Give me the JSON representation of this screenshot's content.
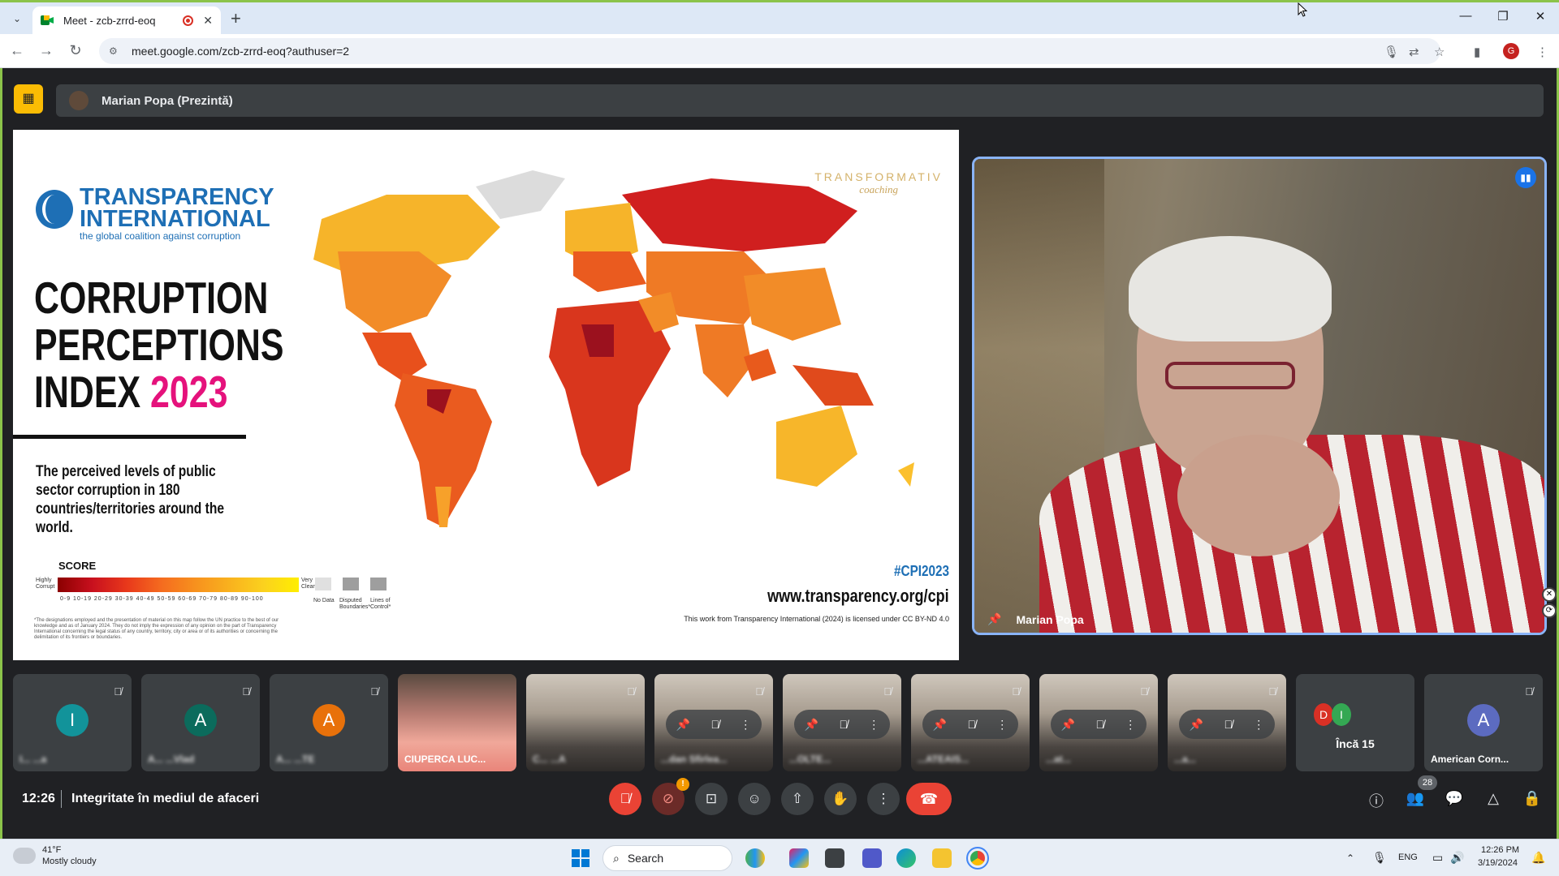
{
  "browser": {
    "tab_title": "Meet - zcb-zrrd-eoq",
    "url": "meet.google.com/zcb-zrrd-eoq?authuser=2",
    "profile_initial": "G"
  },
  "meet": {
    "presenter_label": "Marian Popa (Prezintă)",
    "speaker_name": "Marian Popa",
    "clock": "12:26",
    "meeting_name": "Integritate în mediul de afaceri",
    "people_count": "28",
    "more_label": "Încă 15",
    "more_initials": [
      "D",
      "I"
    ],
    "warning_badge": "!"
  },
  "slide": {
    "org_name_line1": "TRANSPARENCY",
    "org_name_line2": "INTERNATIONAL",
    "org_tagline": "the global coalition against corruption",
    "title_line1": "CORRUPTION",
    "title_line2": "PERCEPTIONS",
    "title_line3_prefix": "INDEX",
    "title_year": "2023",
    "description": "The perceived levels of public sector corruption in 180 countries/territories around the world.",
    "score_label": "SCORE",
    "scale_low": "Highly Corrupt",
    "scale_high": "Very Clean",
    "scale_ticks": "0-9  10-19  20-29  30-39  40-49  50-59  60-69  70-79  80-89  90-100",
    "legend_nodata": "No Data",
    "legend_disputed": "Disputed Boundaries*",
    "legend_lines": "Lines of Control*",
    "fineprint": "*The designations employed and the presentation of material on this map follow the UN practice to the best of our knowledge and as of January 2024. They do not imply the expression of any opinion on the part of Transparency International concerning the legal status of any country, territory, city or area or of its authorities or concerning the delimitation of its frontiers or boundaries.",
    "watermark_line1": "TRANSFORMATIV",
    "watermark_line2": "coaching",
    "hashtag": "#CPI2023",
    "site": "www.transparency.org/cpi",
    "license": "This work from Transparency International (2024) is licensed under CC BY-ND 4.0"
  },
  "tiles": [
    {
      "type": "avatar",
      "initial": "I",
      "color": "#12939a",
      "name": "I... ...a"
    },
    {
      "type": "avatar",
      "initial": "A",
      "color": "#0b6b5c",
      "name": "A... ...Vlad"
    },
    {
      "type": "avatar",
      "initial": "A",
      "color": "#e8710a",
      "name": "A... ...TE"
    },
    {
      "type": "face",
      "name": "CIUPERCA LUC..."
    },
    {
      "type": "video",
      "name": "C... ...A"
    },
    {
      "type": "video",
      "name": "...dan Sfirlea..."
    },
    {
      "type": "video",
      "name": "...OLTE..."
    },
    {
      "type": "video",
      "name": "...ATEAIS..."
    },
    {
      "type": "video",
      "name": "...at..."
    },
    {
      "type": "video",
      "name": "...a..."
    },
    {
      "type": "more"
    },
    {
      "type": "avatar",
      "initial": "A",
      "color": "#5c6bc0",
      "name": "American Corn..."
    }
  ],
  "taskbar": {
    "temperature": "41°F",
    "weather": "Mostly cloudy",
    "search_placeholder": "Search",
    "language": "ENG",
    "time": "12:26 PM",
    "date": "3/19/2024"
  }
}
